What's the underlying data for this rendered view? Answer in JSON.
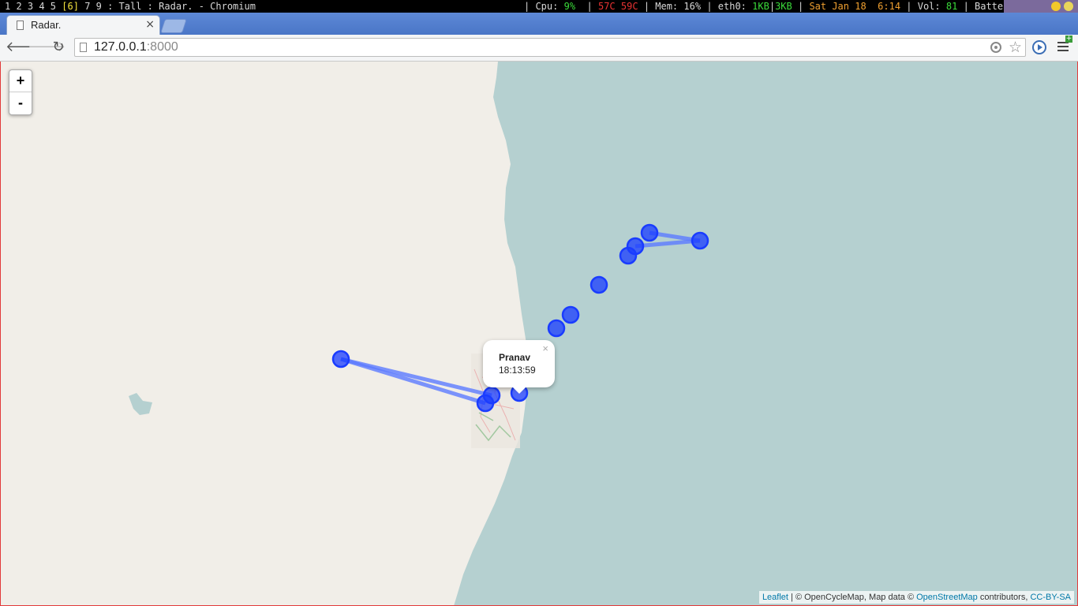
{
  "statusbar": {
    "workspaces_before": "1 2 3 4 5",
    "workspace_current": "[6]",
    "workspaces_after": "7 9",
    "layout": ": Tall :",
    "window_title": "Radar. - Chromium",
    "cpu_label": "| Cpu:",
    "cpu_value": "9%",
    "temp1": "57C",
    "temp2": "59C",
    "mem_label": "| Mem:",
    "mem_value": "16%",
    "net_label": "| eth0:",
    "net_down": "1KB",
    "net_up": "3KB",
    "date": "Sat Jan 18",
    "time": "6:14",
    "vol_label": "| Vol:",
    "vol_value": "81",
    "battery_label": "| Battery"
  },
  "browser": {
    "tab_title": "Radar.",
    "tab_close": "×",
    "url_host": "127.0.0.1",
    "url_port": ":8000",
    "menu_badge": "+"
  },
  "map": {
    "zoom_in": "+",
    "zoom_out": "-",
    "popup_name": "Pranav",
    "popup_time": "18:13:59",
    "popup_close": "×",
    "marker_color": "#1a3cff",
    "track_color": "#5c7bff",
    "sea_color": "#b5d0d0",
    "land_color": "#f1eee8",
    "attribution": {
      "leaflet": "Leaflet",
      "middle": "| © OpenCycleMap, Map data ©",
      "osm": "OpenStreetMap",
      "contributors": "contributors,",
      "license": "CC-BY-SA"
    }
  }
}
